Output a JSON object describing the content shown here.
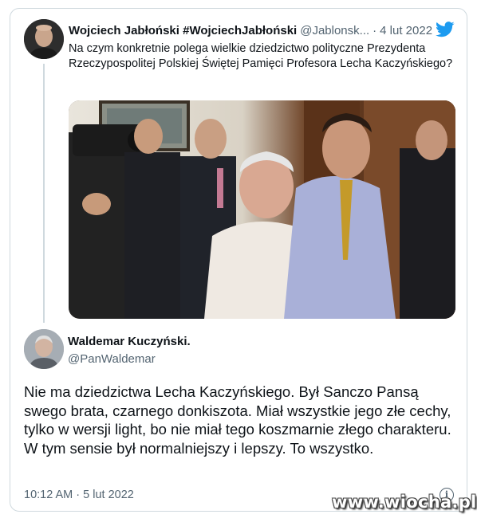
{
  "quoted_tweet": {
    "author_name": "Wojciech Jabłoński #WojciechJabłoński",
    "author_handle": "@Jablonsk...",
    "separator": "·",
    "date": "4 lut 2022",
    "text": "Na czym konkretnie polega wielkie dziedzictwo polityczne Prezydenta Rzeczypospolitej Polskiej Świętej Pamięci Profesora Lecha Kaczyńskiego?"
  },
  "reply_tweet": {
    "author_name": "Waldemar Kuczyński.",
    "author_handle": "@PanWaldemar",
    "text": "Nie ma dziedzictwa Lecha Kaczyńskiego. Był Sanczo Pansą swego brata, czarnego donkiszota. Miał wszystkie jego złe cechy, tylko w wersji light, bo nie miał tego koszmarnie złego charakteru. W tym sensie był normalniejszy i lepszy. To wszystko.",
    "timestamp": "10:12 AM · 5 lut 2022"
  },
  "watermark": "www.wiocha.pl",
  "colors": {
    "twitter_blue": "#1d9bf0",
    "muted": "#536471",
    "border": "#cfd9de"
  },
  "icons": {
    "platform": "twitter-bird-icon",
    "info": "info-icon"
  }
}
